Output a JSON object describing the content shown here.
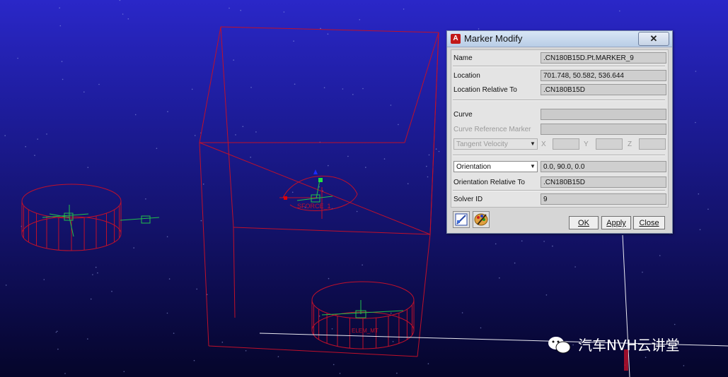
{
  "dialog": {
    "title": "Marker Modify",
    "app_icon_letter": "A",
    "close_glyph": "✕",
    "fields": {
      "name": {
        "label": "Name",
        "value": ".CN180B15D.Pt.MARKER_9"
      },
      "location": {
        "label": "Location",
        "value": "701.748, 50.582, 536.644"
      },
      "location_relative_to": {
        "label": "Location Relative To",
        "value": ".CN180B15D"
      },
      "curve": {
        "label": "Curve",
        "value": ""
      },
      "curve_reference_marker": {
        "label": "Curve Reference Marker",
        "value": ""
      },
      "tangent_velocity": {
        "selected": "Tangent Velocity",
        "x_label": "X",
        "y_label": "Y",
        "z_label": "Z"
      },
      "orientation": {
        "selected": "Orientation",
        "value": "0.0, 90.0, 0.0"
      },
      "orientation_relative_to": {
        "label": "Orientation Relative To",
        "value": ".CN180B15D"
      },
      "solver_id": {
        "label": "Solver ID",
        "value": "9"
      }
    },
    "buttons": {
      "ok": "OK",
      "apply": "Apply",
      "close": "Close"
    },
    "tool_icons": [
      "edit-properties-icon",
      "appearance-palette-icon"
    ]
  },
  "scene": {
    "labels": {
      "center_label": "SFORCE_1",
      "bottom_label": "ELEM_MT"
    },
    "colors": {
      "wireframe": "#c0102a",
      "marker": "#22c04a",
      "annotation": "#0a1fb8"
    }
  },
  "watermark": {
    "text": "汽车NVH云讲堂",
    "icon": "wechat-icon"
  }
}
